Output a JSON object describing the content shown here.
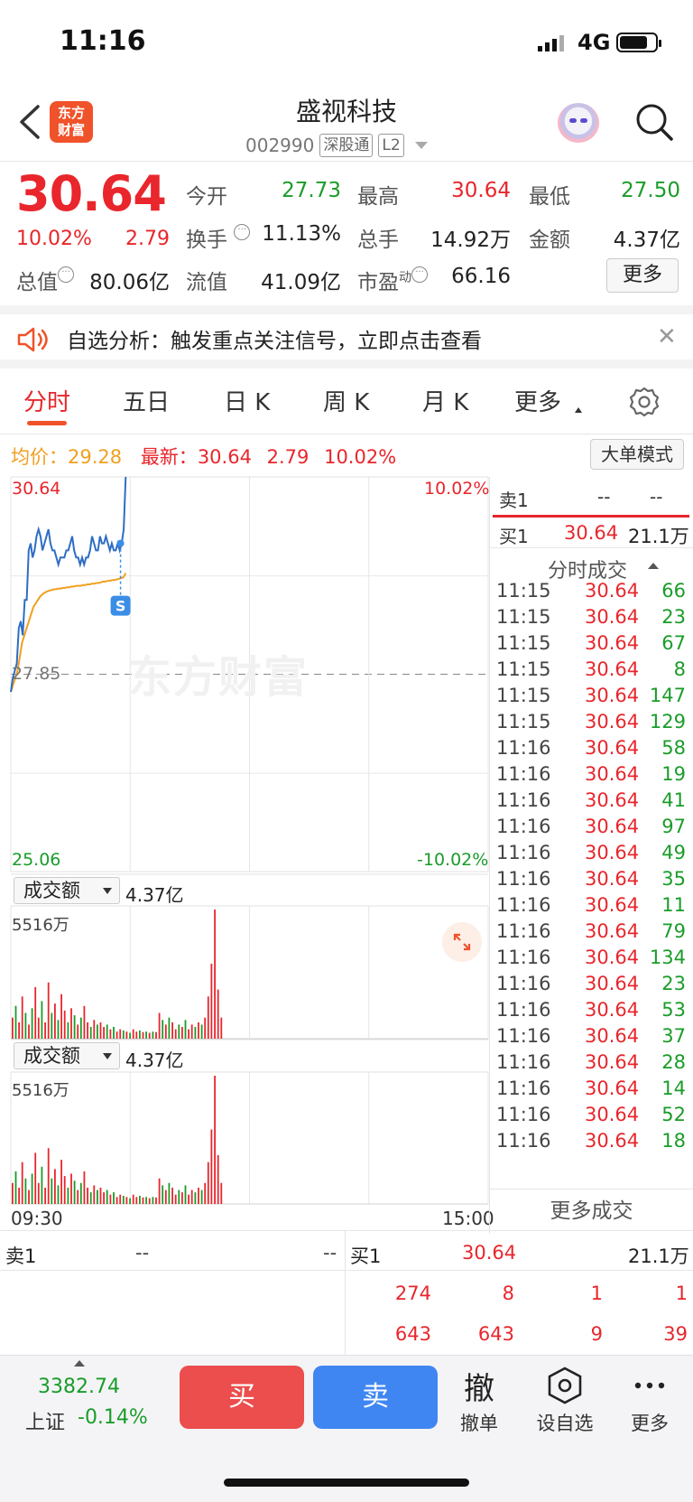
{
  "status_bar": {
    "time": "11:16",
    "network": "4G"
  },
  "header": {
    "logo_text": "东方财富",
    "stock_name": "盛视科技",
    "stock_code": "002990",
    "tag_market": "深股通",
    "tag_level": "L2"
  },
  "quote": {
    "price": "30.64",
    "change_pct": "10.02%",
    "change": "2.79",
    "open_label": "今开",
    "open": "27.73",
    "high_label": "最高",
    "high": "30.64",
    "low_label": "最低",
    "low": "27.50",
    "turnover_label": "换手",
    "turnover": "11.13%",
    "volume_label": "总手",
    "volume": "14.92万",
    "amount_label": "金额",
    "amount": "4.37亿",
    "mktcap_label": "总值",
    "mktcap": "80.06亿",
    "float_label": "流值",
    "float_cap": "41.09亿",
    "pe_label": "市盈",
    "pe_sup": "动",
    "pe": "66.16",
    "more_label": "更多"
  },
  "notice": {
    "text": "自选分析：触发重点关注信号，立即点击查看"
  },
  "tabs": [
    {
      "label": "分时"
    },
    {
      "label": "五日"
    },
    {
      "label": "日 K"
    },
    {
      "label": "周 K"
    },
    {
      "label": "月 K"
    },
    {
      "label": "更多"
    }
  ],
  "info_line": {
    "avg_label": "均价：",
    "avg_value": "29.28",
    "latest_label": "最新：",
    "latest_value": "30.64",
    "latest_change": "2.79",
    "latest_pct": "10.02%",
    "big_order_label": "大单模式"
  },
  "chart_labels": {
    "price_top": "30.64",
    "pct_top": "10.02%",
    "price_mid": "27.85",
    "price_bottom": "25.06",
    "pct_bottom": "-10.02%",
    "marker": "S",
    "watermark": "东方财富",
    "vol_selector": "成交额",
    "vol_total": "4.37亿",
    "vol_max": "5516万",
    "time_start": "09:30",
    "time_end": "15:00"
  },
  "chart_data": {
    "type": "line",
    "ylim": [
      25.06,
      30.64
    ],
    "reference_price": 27.85,
    "series": [
      {
        "values": [
          27.6,
          27.8,
          27.9,
          28.0,
          28.5,
          28.6,
          28.4,
          28.9,
          28.9,
          29.6,
          29.7,
          29.5,
          29.6,
          29.8,
          29.9,
          29.8,
          29.6,
          29.7,
          29.8,
          29.9,
          29.7,
          29.6,
          29.6,
          29.5,
          29.4,
          29.5,
          29.5,
          29.5,
          29.6,
          29.6,
          29.7,
          29.8,
          29.6,
          29.5,
          29.5,
          29.4,
          29.5,
          29.4,
          29.5,
          29.5,
          29.6,
          29.8,
          29.7,
          29.6,
          29.6,
          29.8,
          29.7,
          29.7,
          29.8,
          29.7,
          29.6,
          29.7,
          29.6,
          29.6,
          29.7,
          29.6,
          29.7,
          29.9,
          30.64
        ]
      },
      {
        "values": [
          27.6,
          27.7,
          27.8,
          27.9,
          28.1,
          28.3,
          28.4,
          28.5,
          28.6,
          28.7,
          28.8,
          28.85,
          28.9,
          28.95,
          28.98,
          29.0,
          29.02,
          29.03,
          29.04,
          29.05,
          29.05,
          29.06,
          29.06,
          29.07,
          29.07,
          29.08,
          29.08,
          29.09,
          29.09,
          29.1,
          29.1,
          29.1,
          29.11,
          29.11,
          29.12,
          29.12,
          29.13,
          29.13,
          29.14,
          29.14,
          29.15,
          29.16,
          29.16,
          29.17,
          29.17,
          29.18,
          29.18,
          29.19,
          29.2,
          29.21,
          29.22,
          29.28
        ]
      }
    ],
    "volume_ylim": [
      0,
      5516
    ],
    "volume": [
      900,
      1400,
      700,
      1800,
      1100,
      600,
      1300,
      2200,
      900,
      1600,
      700,
      2400,
      1100,
      1500,
      800,
      1900,
      1200,
      700,
      1300,
      1000,
      600,
      900,
      1400,
      700,
      500,
      800,
      600,
      700,
      500,
      600,
      400,
      500,
      300,
      400,
      350,
      300,
      250,
      400,
      300,
      350,
      280,
      300,
      250,
      300,
      280,
      1100,
      800,
      600,
      900,
      700,
      400,
      600,
      500,
      800,
      400,
      600,
      500,
      700,
      600,
      900,
      1800,
      3200,
      5516,
      2100,
      900
    ],
    "volume_colors": [
      "r",
      "g",
      "r",
      "r",
      "g",
      "r",
      "g",
      "r",
      "r",
      "g",
      "r",
      "r",
      "g",
      "r",
      "g",
      "r",
      "r",
      "g",
      "r",
      "g",
      "r",
      "g",
      "r",
      "r",
      "g",
      "r",
      "g",
      "r",
      "r",
      "g",
      "r",
      "g",
      "r",
      "r",
      "g",
      "r",
      "g",
      "r",
      "r",
      "g",
      "r",
      "g",
      "r",
      "g",
      "r",
      "r",
      "g",
      "r",
      "g",
      "r",
      "r",
      "g",
      "r",
      "g",
      "r",
      "r",
      "g",
      "r",
      "g",
      "r",
      "r",
      "r",
      "r",
      "r",
      "r"
    ]
  },
  "right_panel": {
    "sell1_label": "卖1",
    "sell1_price": "--",
    "sell1_vol": "--",
    "buy1_label": "买1",
    "buy1_price": "30.64",
    "buy1_vol": "21.1万",
    "title": "分时成交",
    "trades": [
      {
        "t": "11:15",
        "p": "30.64",
        "v": "66"
      },
      {
        "t": "11:15",
        "p": "30.64",
        "v": "23"
      },
      {
        "t": "11:15",
        "p": "30.64",
        "v": "67"
      },
      {
        "t": "11:15",
        "p": "30.64",
        "v": "8"
      },
      {
        "t": "11:15",
        "p": "30.64",
        "v": "147"
      },
      {
        "t": "11:15",
        "p": "30.64",
        "v": "129"
      },
      {
        "t": "11:16",
        "p": "30.64",
        "v": "58"
      },
      {
        "t": "11:16",
        "p": "30.64",
        "v": "19"
      },
      {
        "t": "11:16",
        "p": "30.64",
        "v": "41"
      },
      {
        "t": "11:16",
        "p": "30.64",
        "v": "97"
      },
      {
        "t": "11:16",
        "p": "30.64",
        "v": "49"
      },
      {
        "t": "11:16",
        "p": "30.64",
        "v": "35"
      },
      {
        "t": "11:16",
        "p": "30.64",
        "v": "11"
      },
      {
        "t": "11:16",
        "p": "30.64",
        "v": "79"
      },
      {
        "t": "11:16",
        "p": "30.64",
        "v": "134"
      },
      {
        "t": "11:16",
        "p": "30.64",
        "v": "23"
      },
      {
        "t": "11:16",
        "p": "30.64",
        "v": "53"
      },
      {
        "t": "11:16",
        "p": "30.64",
        "v": "37"
      },
      {
        "t": "11:16",
        "p": "30.64",
        "v": "28"
      },
      {
        "t": "11:16",
        "p": "30.64",
        "v": "14"
      },
      {
        "t": "11:16",
        "p": "30.64",
        "v": "52"
      },
      {
        "t": "11:16",
        "p": "30.64",
        "v": "18"
      }
    ],
    "more_label": "更多成交"
  },
  "order_book": {
    "sell1_label": "卖1",
    "sell1_price": "--",
    "sell1_vol": "--",
    "buy1_label": "买1",
    "buy1_price": "30.64",
    "buy1_vol": "21.1万",
    "row2": [
      "274",
      "8",
      "1",
      "1"
    ],
    "row3": [
      "643",
      "643",
      "9",
      "39"
    ]
  },
  "bottom_bar": {
    "index_value": "3382.74",
    "index_name": "上证",
    "index_pct": "-0.14%",
    "buy_label": "买",
    "sell_label": "卖",
    "cancel_icon": "撤",
    "cancel_label": "撤单",
    "watch_label": "设自选",
    "more_label": "更多"
  },
  "colors": {
    "up": "#e8262c",
    "down": "#1a9c2a",
    "price_line": "#2e6dc4",
    "avg_line": "#f0a020",
    "brand": "#f0522a"
  }
}
